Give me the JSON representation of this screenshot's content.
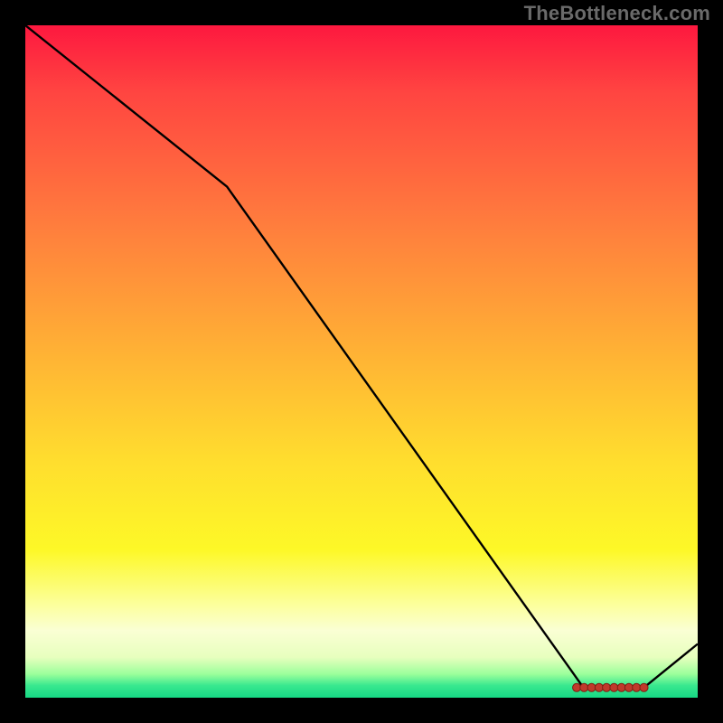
{
  "watermark": "TheBottleneck.com",
  "chart_data": {
    "type": "line",
    "title": "",
    "xlabel": "",
    "ylabel": "",
    "xlim": [
      0,
      100
    ],
    "ylim": [
      0,
      100
    ],
    "x": [
      0,
      30,
      83,
      92,
      100
    ],
    "values": [
      100,
      76,
      1.5,
      1.5,
      8
    ],
    "markers": {
      "x_start": 82,
      "x_end": 92,
      "count": 10,
      "y": 1.5
    },
    "grid": false,
    "legend": null
  }
}
